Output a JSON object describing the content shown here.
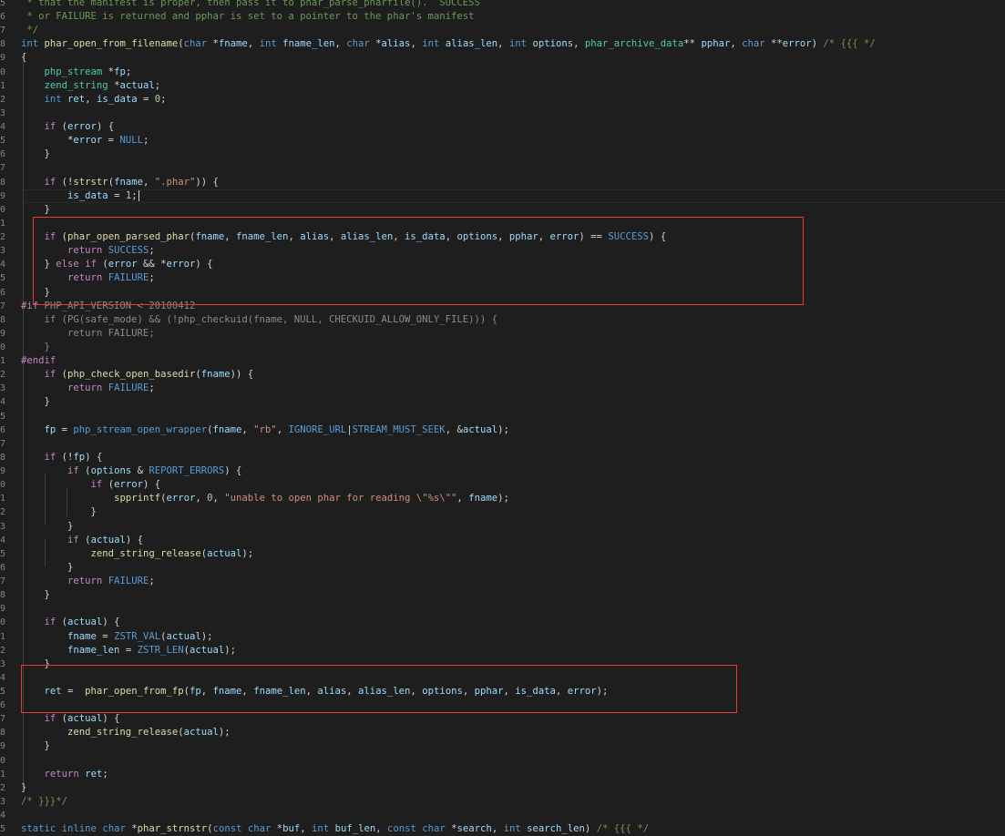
{
  "editor": {
    "theme_colors": {
      "background": "#1e1e1e",
      "keyword": "#569cd6",
      "control": "#c586c0",
      "function": "#dcdcaa",
      "variable": "#9cdcfe",
      "type": "#4ec9b0",
      "string": "#ce9178",
      "number": "#b5cea8",
      "comment": "#6a9955",
      "highlight_box": "#e03c3c"
    },
    "line_numbers": [
      "5",
      "6",
      "7",
      "8",
      "9",
      "0",
      "1",
      "2",
      "3",
      "4",
      "5",
      "6",
      "7",
      "8",
      "9",
      "0",
      "1",
      "2",
      "3",
      "4",
      "5",
      "6",
      "7",
      "8",
      "9",
      "0",
      "1",
      "2",
      "3",
      "4",
      "5",
      "6",
      "7",
      "8",
      "9",
      "0",
      "1",
      "2",
      "3",
      "4",
      "5",
      "6",
      "7",
      "8",
      "9",
      "0",
      "1",
      "2",
      "3",
      "4",
      "5",
      "6",
      "7",
      "8",
      "9",
      "0",
      "1",
      "2",
      "3",
      "4",
      "5"
    ],
    "highlighted_regions": [
      "phar-open-parsed-phar-block",
      "phar-open-from-fp-call"
    ],
    "lines": [
      [
        [
          "t-com",
          " * that the manifest is proper, then pass it to phar_parse_pharfile().  SUCCESS"
        ]
      ],
      [
        [
          "t-com",
          " * or FAILURE is returned and pphar is set to a pointer to the phar's manifest"
        ]
      ],
      [
        [
          "t-com",
          " */"
        ]
      ],
      [
        [
          "t-kw",
          "int"
        ],
        [
          "t-pun",
          " "
        ],
        [
          "t-fn",
          "phar_open_from_filename"
        ],
        [
          "t-pun",
          "("
        ],
        [
          "t-kw",
          "char"
        ],
        [
          "t-pun",
          " *"
        ],
        [
          "t-var",
          "fname"
        ],
        [
          "t-pun",
          ", "
        ],
        [
          "t-kw",
          "int"
        ],
        [
          "t-pun",
          " "
        ],
        [
          "t-var",
          "fname_len"
        ],
        [
          "t-pun",
          ", "
        ],
        [
          "t-kw",
          "char"
        ],
        [
          "t-pun",
          " *"
        ],
        [
          "t-var",
          "alias"
        ],
        [
          "t-pun",
          ", "
        ],
        [
          "t-kw",
          "int"
        ],
        [
          "t-pun",
          " "
        ],
        [
          "t-var",
          "alias_len"
        ],
        [
          "t-pun",
          ", "
        ],
        [
          "t-kw",
          "int"
        ],
        [
          "t-pun",
          " "
        ],
        [
          "t-var",
          "options"
        ],
        [
          "t-pun",
          ", "
        ],
        [
          "t-type",
          "phar_archive_data"
        ],
        [
          "t-pun",
          "** "
        ],
        [
          "t-var",
          "pphar"
        ],
        [
          "t-pun",
          ", "
        ],
        [
          "t-kw",
          "char"
        ],
        [
          "t-pun",
          " **"
        ],
        [
          "t-var",
          "error"
        ],
        [
          "t-pun",
          ") "
        ],
        [
          "t-com",
          "/* {{{ */"
        ]
      ],
      [
        [
          "t-pun",
          "{"
        ]
      ],
      [
        [
          "t-pun",
          "    "
        ],
        [
          "t-type",
          "php_stream"
        ],
        [
          "t-pun",
          " *"
        ],
        [
          "t-var",
          "fp"
        ],
        [
          "t-pun",
          ";"
        ]
      ],
      [
        [
          "t-pun",
          "    "
        ],
        [
          "t-type",
          "zend_string"
        ],
        [
          "t-pun",
          " *"
        ],
        [
          "t-var",
          "actual"
        ],
        [
          "t-pun",
          ";"
        ]
      ],
      [
        [
          "t-pun",
          "    "
        ],
        [
          "t-kw",
          "int"
        ],
        [
          "t-pun",
          " "
        ],
        [
          "t-var",
          "ret"
        ],
        [
          "t-pun",
          ", "
        ],
        [
          "t-var",
          "is_data"
        ],
        [
          "t-pun",
          " = "
        ],
        [
          "t-num",
          "0"
        ],
        [
          "t-pun",
          ";"
        ]
      ],
      [],
      [
        [
          "t-pun",
          "    "
        ],
        [
          "t-ctl",
          "if"
        ],
        [
          "t-pun",
          " ("
        ],
        [
          "t-var",
          "error"
        ],
        [
          "t-pun",
          ") {"
        ]
      ],
      [
        [
          "t-pun",
          "        *"
        ],
        [
          "t-var",
          "error"
        ],
        [
          "t-pun",
          " = "
        ],
        [
          "t-mac",
          "NULL"
        ],
        [
          "t-pun",
          ";"
        ]
      ],
      [
        [
          "t-pun",
          "    }"
        ]
      ],
      [],
      [
        [
          "t-pun",
          "    "
        ],
        [
          "t-ctl",
          "if"
        ],
        [
          "t-pun",
          " (!"
        ],
        [
          "t-fn",
          "strstr"
        ],
        [
          "t-pun",
          "("
        ],
        [
          "t-var",
          "fname"
        ],
        [
          "t-pun",
          ", "
        ],
        [
          "t-str",
          "\".phar\""
        ],
        [
          "t-pun",
          ")) {"
        ]
      ],
      [
        [
          "t-pun",
          "        "
        ],
        [
          "t-var",
          "is_data"
        ],
        [
          "t-pun",
          " = "
        ],
        [
          "t-num",
          "1"
        ],
        [
          "t-pun",
          ";"
        ]
      ],
      [
        [
          "t-pun",
          "    }"
        ]
      ],
      [],
      [
        [
          "t-pun",
          "    "
        ],
        [
          "t-ctl",
          "if"
        ],
        [
          "t-pun",
          " ("
        ],
        [
          "t-fn",
          "phar_open_parsed_phar"
        ],
        [
          "t-pun",
          "("
        ],
        [
          "t-var",
          "fname"
        ],
        [
          "t-pun",
          ", "
        ],
        [
          "t-var",
          "fname_len"
        ],
        [
          "t-pun",
          ", "
        ],
        [
          "t-var",
          "alias"
        ],
        [
          "t-pun",
          ", "
        ],
        [
          "t-var",
          "alias_len"
        ],
        [
          "t-pun",
          ", "
        ],
        [
          "t-var",
          "is_data"
        ],
        [
          "t-pun",
          ", "
        ],
        [
          "t-var",
          "options"
        ],
        [
          "t-pun",
          ", "
        ],
        [
          "t-var",
          "pphar"
        ],
        [
          "t-pun",
          ", "
        ],
        [
          "t-var",
          "error"
        ],
        [
          "t-pun",
          ") == "
        ],
        [
          "t-mac",
          "SUCCESS"
        ],
        [
          "t-pun",
          ") {"
        ]
      ],
      [
        [
          "t-pun",
          "        "
        ],
        [
          "t-ctl",
          "return"
        ],
        [
          "t-pun",
          " "
        ],
        [
          "t-mac",
          "SUCCESS"
        ],
        [
          "t-pun",
          ";"
        ]
      ],
      [
        [
          "t-pun",
          "    } "
        ],
        [
          "t-ctl",
          "else"
        ],
        [
          "t-pun",
          " "
        ],
        [
          "t-ctl",
          "if"
        ],
        [
          "t-pun",
          " ("
        ],
        [
          "t-var",
          "error"
        ],
        [
          "t-pun",
          " && *"
        ],
        [
          "t-var",
          "error"
        ],
        [
          "t-pun",
          ") {"
        ]
      ],
      [
        [
          "t-pun",
          "        "
        ],
        [
          "t-ctl",
          "return"
        ],
        [
          "t-pun",
          " "
        ],
        [
          "t-mac",
          "FAILURE"
        ],
        [
          "t-pun",
          ";"
        ]
      ],
      [
        [
          "t-pun",
          "    }"
        ]
      ],
      [
        [
          "t-pp",
          "#if"
        ],
        [
          "t-dim",
          " PHP_API_VERSION < 20100412"
        ]
      ],
      [
        [
          "t-dim",
          "    if (PG(safe_mode) && (!php_checkuid(fname, NULL, CHECKUID_ALLOW_ONLY_FILE))) {"
        ]
      ],
      [
        [
          "t-dim",
          "        return FAILURE;"
        ]
      ],
      [
        [
          "t-dim",
          "    }"
        ]
      ],
      [
        [
          "t-pp",
          "#endif"
        ]
      ],
      [
        [
          "t-pun",
          "    "
        ],
        [
          "t-ctl",
          "if"
        ],
        [
          "t-pun",
          " ("
        ],
        [
          "t-fn",
          "php_check_open_basedir"
        ],
        [
          "t-pun",
          "("
        ],
        [
          "t-var",
          "fname"
        ],
        [
          "t-pun",
          ")) {"
        ]
      ],
      [
        [
          "t-pun",
          "        "
        ],
        [
          "t-ctl",
          "return"
        ],
        [
          "t-pun",
          " "
        ],
        [
          "t-mac",
          "FAILURE"
        ],
        [
          "t-pun",
          ";"
        ]
      ],
      [
        [
          "t-pun",
          "    }"
        ]
      ],
      [],
      [
        [
          "t-pun",
          "    "
        ],
        [
          "t-var",
          "fp"
        ],
        [
          "t-pun",
          " = "
        ],
        [
          "t-mac",
          "php_stream_open_wrapper"
        ],
        [
          "t-pun",
          "("
        ],
        [
          "t-var",
          "fname"
        ],
        [
          "t-pun",
          ", "
        ],
        [
          "t-str",
          "\"rb\""
        ],
        [
          "t-pun",
          ", "
        ],
        [
          "t-mac",
          "IGNORE_URL"
        ],
        [
          "t-pun",
          "|"
        ],
        [
          "t-mac",
          "STREAM_MUST_SEEK"
        ],
        [
          "t-pun",
          ", &"
        ],
        [
          "t-var",
          "actual"
        ],
        [
          "t-pun",
          ");"
        ]
      ],
      [],
      [
        [
          "t-pun",
          "    "
        ],
        [
          "t-ctl",
          "if"
        ],
        [
          "t-pun",
          " (!"
        ],
        [
          "t-var",
          "fp"
        ],
        [
          "t-pun",
          ") {"
        ]
      ],
      [
        [
          "t-pun",
          "        "
        ],
        [
          "t-ctl",
          "if"
        ],
        [
          "t-pun",
          " ("
        ],
        [
          "t-var",
          "options"
        ],
        [
          "t-pun",
          " & "
        ],
        [
          "t-mac",
          "REPORT_ERRORS"
        ],
        [
          "t-pun",
          ") {"
        ]
      ],
      [
        [
          "t-pun",
          "            "
        ],
        [
          "t-ctl",
          "if"
        ],
        [
          "t-pun",
          " ("
        ],
        [
          "t-var",
          "error"
        ],
        [
          "t-pun",
          ") {"
        ]
      ],
      [
        [
          "t-pun",
          "                "
        ],
        [
          "t-fn",
          "spprintf"
        ],
        [
          "t-pun",
          "("
        ],
        [
          "t-var",
          "error"
        ],
        [
          "t-pun",
          ", "
        ],
        [
          "t-num",
          "0"
        ],
        [
          "t-pun",
          ", "
        ],
        [
          "t-str",
          "\"unable to open phar for reading \\\"%s\\\"\""
        ],
        [
          "t-pun",
          ", "
        ],
        [
          "t-var",
          "fname"
        ],
        [
          "t-pun",
          ");"
        ]
      ],
      [
        [
          "t-pun",
          "            }"
        ]
      ],
      [
        [
          "t-pun",
          "        }"
        ]
      ],
      [
        [
          "t-pun",
          "        "
        ],
        [
          "t-ctl",
          "if"
        ],
        [
          "t-pun",
          " ("
        ],
        [
          "t-var",
          "actual"
        ],
        [
          "t-pun",
          ") {"
        ]
      ],
      [
        [
          "t-pun",
          "            "
        ],
        [
          "t-fn",
          "zend_string_release"
        ],
        [
          "t-pun",
          "("
        ],
        [
          "t-var",
          "actual"
        ],
        [
          "t-pun",
          ");"
        ]
      ],
      [
        [
          "t-pun",
          "        }"
        ]
      ],
      [
        [
          "t-pun",
          "        "
        ],
        [
          "t-ctl",
          "return"
        ],
        [
          "t-pun",
          " "
        ],
        [
          "t-mac",
          "FAILURE"
        ],
        [
          "t-pun",
          ";"
        ]
      ],
      [
        [
          "t-pun",
          "    }"
        ]
      ],
      [],
      [
        [
          "t-pun",
          "    "
        ],
        [
          "t-ctl",
          "if"
        ],
        [
          "t-pun",
          " ("
        ],
        [
          "t-var",
          "actual"
        ],
        [
          "t-pun",
          ") {"
        ]
      ],
      [
        [
          "t-pun",
          "        "
        ],
        [
          "t-var",
          "fname"
        ],
        [
          "t-pun",
          " = "
        ],
        [
          "t-mac",
          "ZSTR_VAL"
        ],
        [
          "t-pun",
          "("
        ],
        [
          "t-var",
          "actual"
        ],
        [
          "t-pun",
          ");"
        ]
      ],
      [
        [
          "t-pun",
          "        "
        ],
        [
          "t-var",
          "fname_len"
        ],
        [
          "t-pun",
          " = "
        ],
        [
          "t-mac",
          "ZSTR_LEN"
        ],
        [
          "t-pun",
          "("
        ],
        [
          "t-var",
          "actual"
        ],
        [
          "t-pun",
          ");"
        ]
      ],
      [
        [
          "t-pun",
          "    }"
        ]
      ],
      [],
      [
        [
          "t-pun",
          "    "
        ],
        [
          "t-var",
          "ret"
        ],
        [
          "t-pun",
          " =  "
        ],
        [
          "t-fn",
          "phar_open_from_fp"
        ],
        [
          "t-pun",
          "("
        ],
        [
          "t-var",
          "fp"
        ],
        [
          "t-pun",
          ", "
        ],
        [
          "t-var",
          "fname"
        ],
        [
          "t-pun",
          ", "
        ],
        [
          "t-var",
          "fname_len"
        ],
        [
          "t-pun",
          ", "
        ],
        [
          "t-var",
          "alias"
        ],
        [
          "t-pun",
          ", "
        ],
        [
          "t-var",
          "alias_len"
        ],
        [
          "t-pun",
          ", "
        ],
        [
          "t-var",
          "options"
        ],
        [
          "t-pun",
          ", "
        ],
        [
          "t-var",
          "pphar"
        ],
        [
          "t-pun",
          ", "
        ],
        [
          "t-var",
          "is_data"
        ],
        [
          "t-pun",
          ", "
        ],
        [
          "t-var",
          "error"
        ],
        [
          "t-pun",
          ");"
        ]
      ],
      [],
      [
        [
          "t-pun",
          "    "
        ],
        [
          "t-ctl",
          "if"
        ],
        [
          "t-pun",
          " ("
        ],
        [
          "t-var",
          "actual"
        ],
        [
          "t-pun",
          ") {"
        ]
      ],
      [
        [
          "t-pun",
          "        "
        ],
        [
          "t-fn",
          "zend_string_release"
        ],
        [
          "t-pun",
          "("
        ],
        [
          "t-var",
          "actual"
        ],
        [
          "t-pun",
          ");"
        ]
      ],
      [
        [
          "t-pun",
          "    }"
        ]
      ],
      [],
      [
        [
          "t-pun",
          "    "
        ],
        [
          "t-ctl",
          "return"
        ],
        [
          "t-pun",
          " "
        ],
        [
          "t-var",
          "ret"
        ],
        [
          "t-pun",
          ";"
        ]
      ],
      [
        [
          "t-pun",
          "}"
        ]
      ],
      [
        [
          "t-com",
          "/* }}}*/"
        ]
      ],
      [],
      [
        [
          "t-kw",
          "static"
        ],
        [
          "t-pun",
          " "
        ],
        [
          "t-kw",
          "inline"
        ],
        [
          "t-pun",
          " "
        ],
        [
          "t-kw",
          "char"
        ],
        [
          "t-pun",
          " *"
        ],
        [
          "t-fn",
          "phar_strnstr"
        ],
        [
          "t-pun",
          "("
        ],
        [
          "t-kw",
          "const"
        ],
        [
          "t-pun",
          " "
        ],
        [
          "t-kw",
          "char"
        ],
        [
          "t-pun",
          " *"
        ],
        [
          "t-var",
          "buf"
        ],
        [
          "t-pun",
          ", "
        ],
        [
          "t-kw",
          "int"
        ],
        [
          "t-pun",
          " "
        ],
        [
          "t-var",
          "buf_len"
        ],
        [
          "t-pun",
          ", "
        ],
        [
          "t-kw",
          "const"
        ],
        [
          "t-pun",
          " "
        ],
        [
          "t-kw",
          "char"
        ],
        [
          "t-pun",
          " *"
        ],
        [
          "t-var",
          "search"
        ],
        [
          "t-pun",
          ", "
        ],
        [
          "t-kw",
          "int"
        ],
        [
          "t-pun",
          " "
        ],
        [
          "t-var",
          "search_len"
        ],
        [
          "t-pun",
          ") "
        ],
        [
          "t-com",
          "/* {{{ */"
        ]
      ]
    ]
  }
}
